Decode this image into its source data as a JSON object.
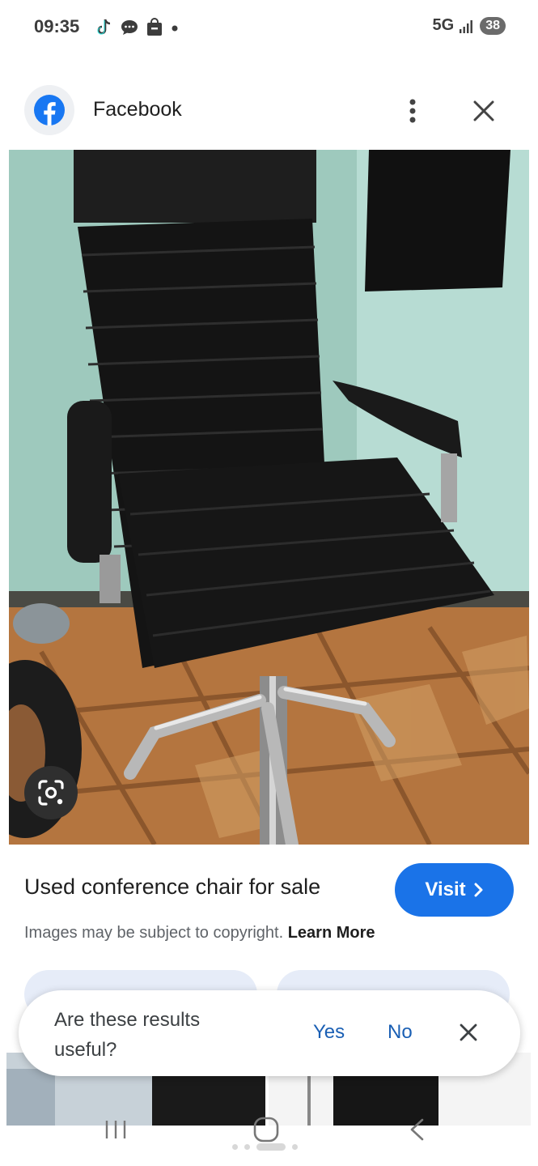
{
  "status_bar": {
    "time": "09:35",
    "network": "5G",
    "battery": "38",
    "icons": [
      "tiktok-icon",
      "chat-bubble-icon",
      "shopping-bag-icon",
      "dot-icon"
    ]
  },
  "header": {
    "site_name": "Facebook",
    "logo_icon": "facebook-logo-icon",
    "more_icon": "more-vert-icon",
    "close_icon": "close-icon"
  },
  "image": {
    "lens_icon": "google-lens-icon"
  },
  "result": {
    "title": "Used conference chair for sale",
    "visit_label": "Visit",
    "copyright_text": "Images may be subject to copyright.",
    "learn_more": "Learn More"
  },
  "survey": {
    "question": "Are these results useful?",
    "yes": "Yes",
    "no": "No"
  },
  "colors": {
    "accent": "#1a73e8",
    "facebook_blue": "#1877f2",
    "text_primary": "#1f1f1f",
    "text_secondary": "#5f6368"
  }
}
